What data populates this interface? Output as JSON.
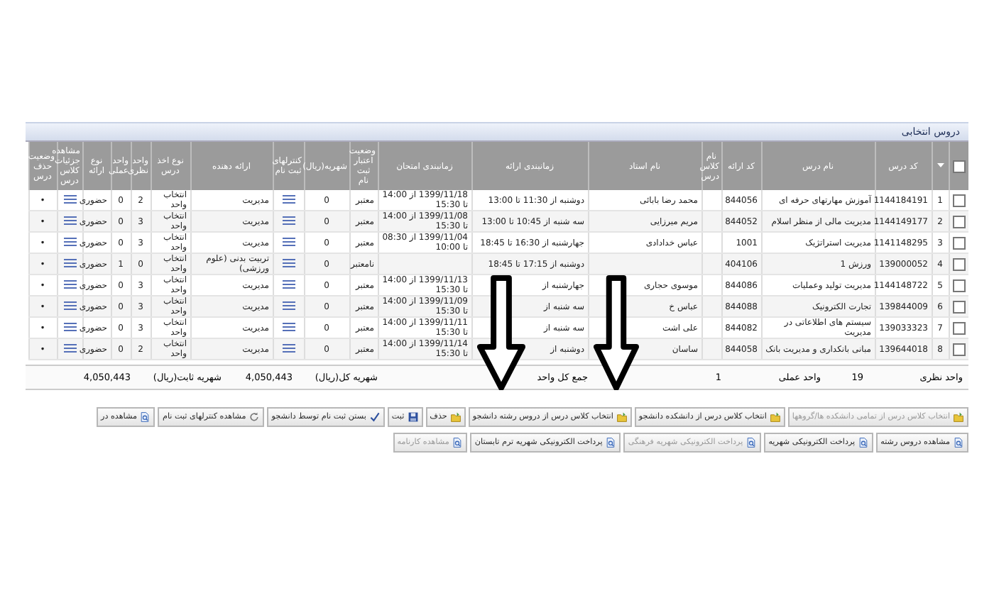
{
  "panel": {
    "title": "دروس انتخابی"
  },
  "table": {
    "select_all": {
      "checked": false
    },
    "columns": [
      "کد درس",
      "نام درس",
      "کد ارائه",
      "نام کلاس درس",
      "نام استاد",
      "زمانبندی ارائه",
      "زمانبندی امتحان",
      "وضعیت اعتبار ثبت نام",
      "شهریه(ریال)",
      "کنترلهای ثبت نام",
      "ارائه دهنده",
      "نوع اخذ درس",
      "واحد نظری",
      "واحد عملی",
      "نوع ارائه",
      "مشاهده جزئیات کلاس درس",
      "وضعیت حذف درس"
    ],
    "rows": [
      {
        "checked": false,
        "number": "1",
        "code": "1144184191",
        "name": "آموزش مهارتهای حرفه ای",
        "offer_code": "844056",
        "instructor": "محمد رضا بابائی",
        "schedule": "دوشنبه از 11:30 تا 13:00",
        "exam": "1399/11/18 از 14:00 تا 15:30",
        "validity": "معتبر",
        "fee": "0",
        "provider": "مدیریت",
        "selection": "انتخاب واحد",
        "theory": "2",
        "practical": "0",
        "delivery": "حضوری",
        "status": "•"
      },
      {
        "checked": false,
        "number": "2",
        "code": "1144149177",
        "name": "مدیریت مالی از منظر اسلام",
        "offer_code": "844052",
        "instructor": "مریم میرزایی",
        "schedule": "سه شنبه از 10:45 تا 13:00",
        "exam": "1399/11/08 از 14:00 تا 15:30",
        "validity": "معتبر",
        "fee": "0",
        "provider": "مدیریت",
        "selection": "انتخاب واحد",
        "theory": "3",
        "practical": "0",
        "delivery": "حضوری",
        "status": "•"
      },
      {
        "checked": false,
        "number": "3",
        "code": "1141148295",
        "name": "مدیریت استراتژیک",
        "offer_code": "1001",
        "instructor": "عباس خدادادی",
        "schedule": "جهارشنبه از 16:30 تا 18:45",
        "exam": "1399/11/04 از 08:30 تا 10:00",
        "validity": "معتبر",
        "fee": "0",
        "provider": "مدیریت",
        "selection": "انتخاب واحد",
        "theory": "3",
        "practical": "0",
        "delivery": "حضوری",
        "status": "•"
      },
      {
        "checked": false,
        "number": "4",
        "code": "139000052",
        "name": "ورزش 1",
        "offer_code": "404106",
        "schedule": "دوشنبه از 17:15 تا 18:45",
        "validity": "نامعتبر",
        "fee": "0",
        "provider": "تربیت بدنی (علوم ورزشی)",
        "selection": "انتخاب واحد",
        "theory": "0",
        "practical": "1",
        "delivery": "حضوری",
        "status": "•"
      },
      {
        "checked": false,
        "number": "5",
        "code": "1144148722",
        "name": "مدیریت تولید وعملیات",
        "offer_code": "844086",
        "instructor": "موسوی حجاری",
        "schedule": "جهارشنبه از",
        "exam": "1399/11/13 از 14:00 تا 15:30",
        "validity": "معتبر",
        "fee": "0",
        "provider": "مدیریت",
        "selection": "انتخاب واحد",
        "theory": "3",
        "practical": "0",
        "delivery": "حضوری",
        "status": "•"
      },
      {
        "checked": false,
        "number": "6",
        "code": "139844009",
        "name": "تجارت الکترونیک",
        "offer_code": "844088",
        "instructor": "عباس خ",
        "schedule": "سه شنبه از",
        "exam": "1399/11/09 از 14:00 تا 15:30",
        "validity": "معتبر",
        "fee": "0",
        "provider": "مدیریت",
        "selection": "انتخاب واحد",
        "theory": "3",
        "practical": "0",
        "delivery": "حضوری",
        "status": "•"
      },
      {
        "checked": false,
        "number": "7",
        "code": "139033323",
        "name": "سیستم های اطلاعاتی در مدیریت",
        "offer_code": "844082",
        "instructor": "علی اشت",
        "schedule": "سه شنبه از",
        "exam": "1399/11/11 از 14:00 تا 15:30",
        "validity": "معتبر",
        "fee": "0",
        "provider": "مدیریت",
        "selection": "انتخاب واحد",
        "theory": "3",
        "practical": "0",
        "delivery": "حضوری",
        "status": "•"
      },
      {
        "checked": false,
        "number": "8",
        "code": "139644018",
        "name": "مبانی بانکداری و مدیریت بانک",
        "offer_code": "844058",
        "instructor": "ساسان",
        "schedule": "دوشنبه از",
        "exam": "1399/11/14 از 14:00 تا 15:30",
        "validity": "معتبر",
        "fee": "0",
        "provider": "مدیریت",
        "selection": "انتخاب واحد",
        "theory": "2",
        "practical": "0",
        "delivery": "حضوری",
        "status": "•"
      }
    ]
  },
  "summary": [
    {
      "label": "واحد نظری",
      "value": "19"
    },
    {
      "label": "واحد عملی",
      "value": "1"
    },
    {
      "label": "جمع کل واحد"
    },
    {
      "label": "شهریه کل(ریال)",
      "value": "4,050,443"
    },
    {
      "label": "شهریه ثابت(ریال)",
      "value": "4,050,443"
    }
  ],
  "actions": [
    {
      "buttons": [
        {
          "label": "انتخاب کلاس درس از تمامی دانشکده ها/گروهها",
          "kind": "folder",
          "disabled": true
        },
        {
          "label": "انتخاب کلاس درس از دانشکده دانشجو",
          "kind": "folder",
          "disabled": false
        },
        {
          "label": "انتخاب کلاس درس از دروس رشته دانشجو",
          "kind": "folder",
          "disabled": false
        },
        {
          "label": "حذف",
          "kind": "folder",
          "disabled": false
        },
        {
          "label": "ثبت",
          "kind": "disk",
          "disabled": false
        },
        {
          "label": "بستن ثبت نام توسط دانشجو",
          "kind": "check",
          "disabled": false
        },
        {
          "label": "مشاهده کنترلهای ثبت نام",
          "kind": "cycle",
          "disabled": false
        },
        {
          "label": "مشاهده در",
          "kind": "page",
          "disabled": false
        }
      ]
    },
    {
      "buttons": [
        {
          "label": "مشاهده دروس رشته",
          "kind": "page",
          "disabled": false
        },
        {
          "label": "پرداخت الکترونیکی شهریه",
          "kind": "page",
          "disabled": false
        },
        {
          "label": "پرداخت الکترونیکی شهریه فرهنگی",
          "kind": "page",
          "disabled": true
        },
        {
          "label": "پرداخت الکترونیکی شهریه ترم تابستان",
          "kind": "page",
          "disabled": false
        },
        {
          "label": "مشاهده کارنامه",
          "kind": "page",
          "disabled": true
        }
      ]
    }
  ]
}
